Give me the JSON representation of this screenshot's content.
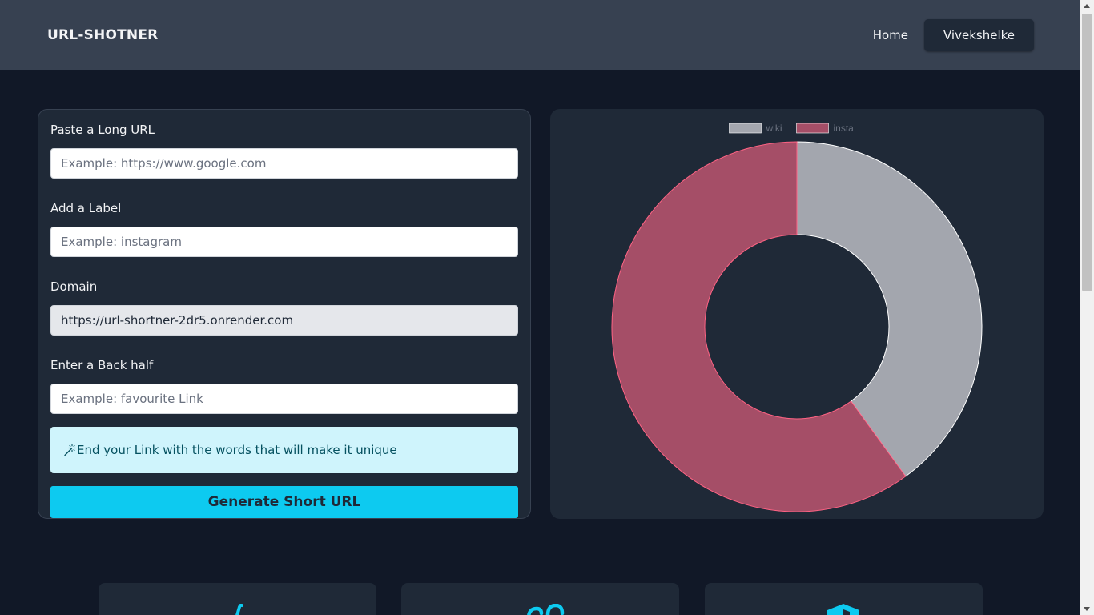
{
  "nav": {
    "brand": "URL-SHOTNER",
    "home_label": "Home",
    "user_label": "Vivekshelke"
  },
  "form": {
    "long_url": {
      "label": "Paste a Long URL",
      "placeholder": "Example: https://www.google.com",
      "value": ""
    },
    "label_field": {
      "label": "Add a Label",
      "placeholder": "Example: instagram",
      "value": ""
    },
    "domain": {
      "label": "Domain",
      "value": "https://url-shortner-2dr5.onrender.com"
    },
    "back_half": {
      "label": "Enter a Back half",
      "placeholder": "Example: favourite Link",
      "value": ""
    },
    "hint": "End your Link with the words that will make it unique",
    "submit_label": "Generate Short URL"
  },
  "chart_data": {
    "type": "doughnut",
    "legend_position": "top",
    "series": [
      {
        "name": "wiki",
        "value": 40,
        "color": "#a3a6ae"
      },
      {
        "name": "insta",
        "value": 60,
        "color": "#a54e67"
      }
    ]
  },
  "colors": {
    "background": "#111827",
    "navbar": "#374151",
    "card": "#1f2937",
    "accent": "#0dcaf0",
    "hint_bg": "#cff4fc"
  },
  "features": [
    {
      "icon": "thumbs-up-icon"
    },
    {
      "icon": "link-icon"
    },
    {
      "icon": "cube-icon"
    }
  ]
}
